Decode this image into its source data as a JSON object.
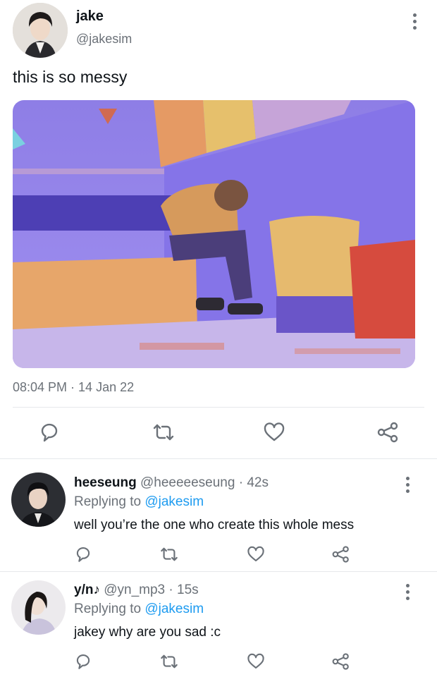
{
  "main_tweet": {
    "author_name": "jake",
    "author_handle": "@jakesim",
    "text": "this is so messy",
    "timestamp": "08:04 PM · 14 Jan 22"
  },
  "replies": [
    {
      "author_name": "heeseung",
      "meta": "@heeeeeseung · 42s",
      "replying_label": "Replying to",
      "replying_to": "@jakesim",
      "text": "well you’re the one who create this whole mess"
    },
    {
      "author_name": "y/n♪",
      "meta": "@yn_mp3 · 15s",
      "replying_label": "Replying to",
      "replying_to": "@jakesim",
      "text": "jakey why are you sad :c"
    }
  ],
  "icons": {
    "reply": "reply-icon",
    "retweet": "retweet-icon",
    "like": "heart-icon",
    "share": "share-icon",
    "more": "more-options-icon"
  },
  "colors": {
    "accent": "#1d9bf0",
    "icon": "#6b7178",
    "text": "#0f1419",
    "divider": "#e6e8eb"
  }
}
